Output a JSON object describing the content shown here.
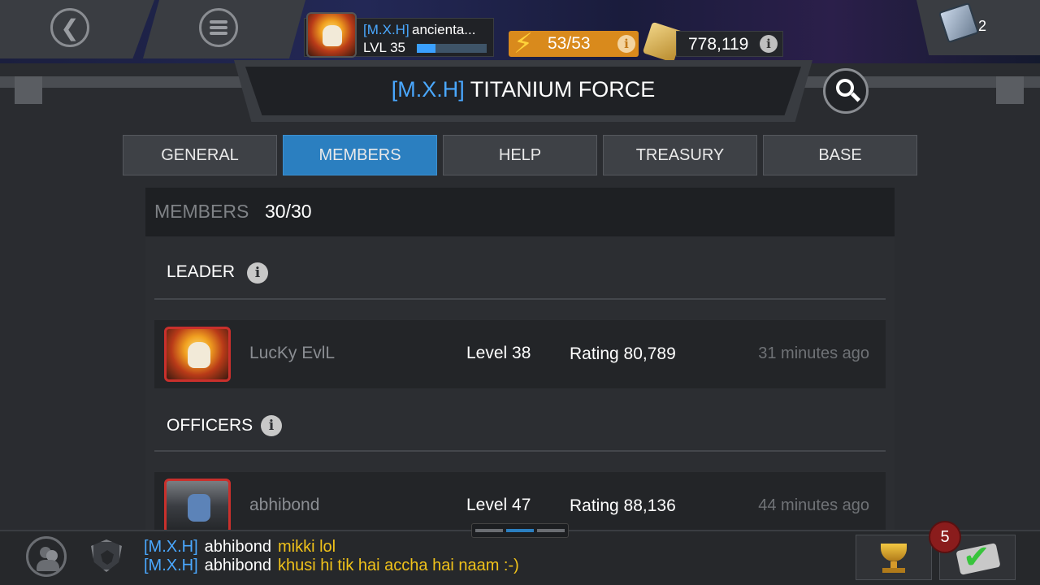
{
  "header": {
    "profile": {
      "tag": "[M.X.H]",
      "name": "ancienta...",
      "level": "LVL 35",
      "xp_progress": 0.27
    },
    "energy": "53/53",
    "gold": "778,119",
    "cards_count": "2"
  },
  "title": {
    "tag": "[M.X.H]",
    "name": "TITANIUM FORCE"
  },
  "tabs": [
    {
      "label": "GENERAL",
      "active": false
    },
    {
      "label": "MEMBERS",
      "active": true
    },
    {
      "label": "HELP",
      "active": false
    },
    {
      "label": "TREASURY",
      "active": false
    },
    {
      "label": "BASE",
      "active": false
    }
  ],
  "members": {
    "label": "MEMBERS",
    "count": "30/30",
    "leader_title": "LEADER",
    "officers_title": "OFFICERS",
    "leader": {
      "name": "LucKy EvlL",
      "level": "Level 38",
      "rating": "Rating 80,789",
      "last_seen": "31 minutes ago"
    },
    "officer": {
      "name": "abhibond",
      "level": "Level 47",
      "rating": "Rating 88,136",
      "last_seen": "44 minutes ago"
    }
  },
  "chat": {
    "messages": [
      {
        "tag": "[M.X.H]",
        "user": "abhibond",
        "text": "mikki lol"
      },
      {
        "tag": "[M.X.H]",
        "user": "abhibond",
        "text": "khusi hi tik hai accha hai naam :-)"
      }
    ],
    "quest_badge": "5"
  },
  "colors": {
    "accent_blue": "#2b7fc0",
    "tag_blue": "#4aa8ff",
    "energy_orange": "#d98a1c",
    "chat_text_yellow": "#f0c21a"
  },
  "icons": [
    "back-icon",
    "menu-icon",
    "energy-icon",
    "gold-icon",
    "cards-icon",
    "search-icon",
    "info-icon",
    "people-icon",
    "shield-icon",
    "trophy-icon",
    "quest-icon"
  ]
}
